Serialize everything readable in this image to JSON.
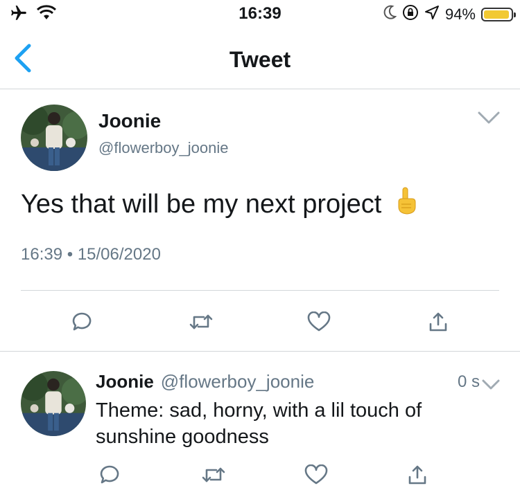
{
  "status_bar": {
    "time": "16:39",
    "battery_percent": "94%",
    "battery_level": 0.94,
    "icons": [
      "airplane-icon",
      "wifi-icon",
      "moon-icon",
      "rotation-lock-icon",
      "location-icon",
      "battery-icon"
    ]
  },
  "nav": {
    "title": "Tweet",
    "back_icon": "chevron-left-icon"
  },
  "main_tweet": {
    "name": "Joonie",
    "handle": "@flowerboy_joonie",
    "text": "Yes that will be my next project",
    "emoji": "☝️",
    "time": "16:39",
    "separator": "•",
    "date": "15/06/2020",
    "actions": [
      "reply-icon",
      "retweet-icon",
      "like-icon",
      "share-icon"
    ]
  },
  "reply_tweet": {
    "name": "Joonie",
    "handle": "@flowerboy_joonie",
    "time": "0 s",
    "text": "Theme: sad, horny, with a lil touch of sunshine goodness",
    "actions": [
      "reply-icon",
      "retweet-icon",
      "like-icon",
      "share-icon"
    ]
  },
  "colors": {
    "accent": "#1da1f2",
    "icon_gray": "#657786",
    "divider": "#d2d6d9",
    "battery": "#f2c933"
  }
}
